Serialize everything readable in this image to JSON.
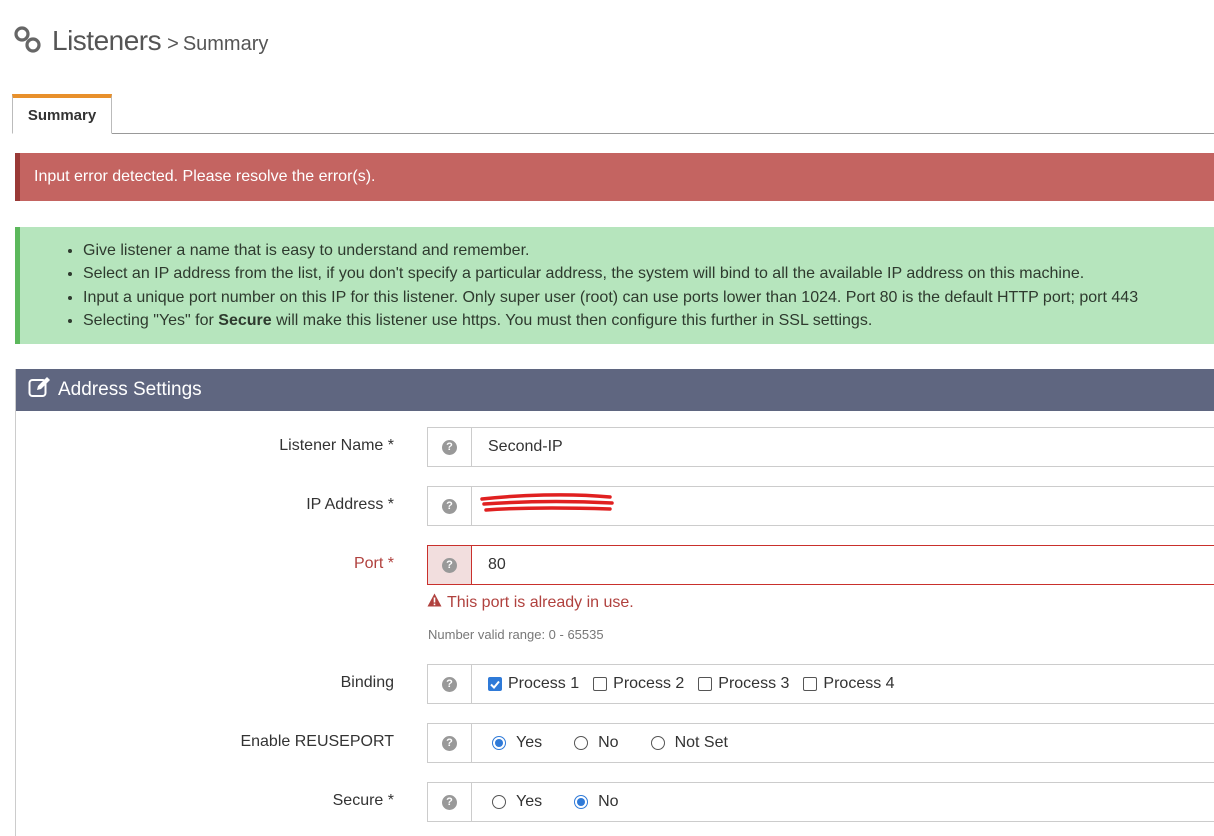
{
  "header": {
    "title": "Listeners",
    "separator": ">",
    "crumb": "Summary"
  },
  "tabs": [
    {
      "label": "Summary",
      "active": true
    }
  ],
  "error_banner": "Input error detected. Please resolve the error(s).",
  "info": {
    "items": [
      "Give listener a name that is easy to understand and remember.",
      "Select an IP address from the list, if you don't specify a particular address, the system will bind to all the available IP address on this machine.",
      "Input a unique port number on this IP for this listener. Only super user (root) can use ports lower than 1024. Port 80 is the default HTTP port; port 443"
    ],
    "item4_pre": "Selecting \"Yes\" for ",
    "item4_bold": "Secure",
    "item4_post": " will make this listener use https. You must then configure this further in SSL settings."
  },
  "panel": {
    "title": "Address Settings"
  },
  "fields": {
    "listener_name": {
      "label": "Listener Name *",
      "value": "Second-IP"
    },
    "ip_address": {
      "label": "IP Address *",
      "value": ""
    },
    "port": {
      "label": "Port *",
      "value": "80",
      "error": "This port is already in use.",
      "hint": "Number valid range: 0 - 65535"
    },
    "binding": {
      "label": "Binding",
      "options": [
        {
          "label": "Process 1",
          "checked": true
        },
        {
          "label": "Process 2",
          "checked": false
        },
        {
          "label": "Process 3",
          "checked": false
        },
        {
          "label": "Process 4",
          "checked": false
        }
      ]
    },
    "reuseport": {
      "label": "Enable REUSEPORT",
      "options": [
        {
          "label": "Yes",
          "selected": true
        },
        {
          "label": "No",
          "selected": false
        },
        {
          "label": "Not Set",
          "selected": false
        }
      ]
    },
    "secure": {
      "label": "Secure *",
      "options": [
        {
          "label": "Yes",
          "selected": false
        },
        {
          "label": "No",
          "selected": true
        }
      ]
    }
  },
  "help_glyph": "?",
  "colors": {
    "accent_tab": "#e8902b",
    "error_bg": "#c46461",
    "info_bg": "#b6e5bd",
    "panel_head": "#5f6680",
    "error_text": "#b0413e",
    "check_blue": "#2f7ad8"
  }
}
